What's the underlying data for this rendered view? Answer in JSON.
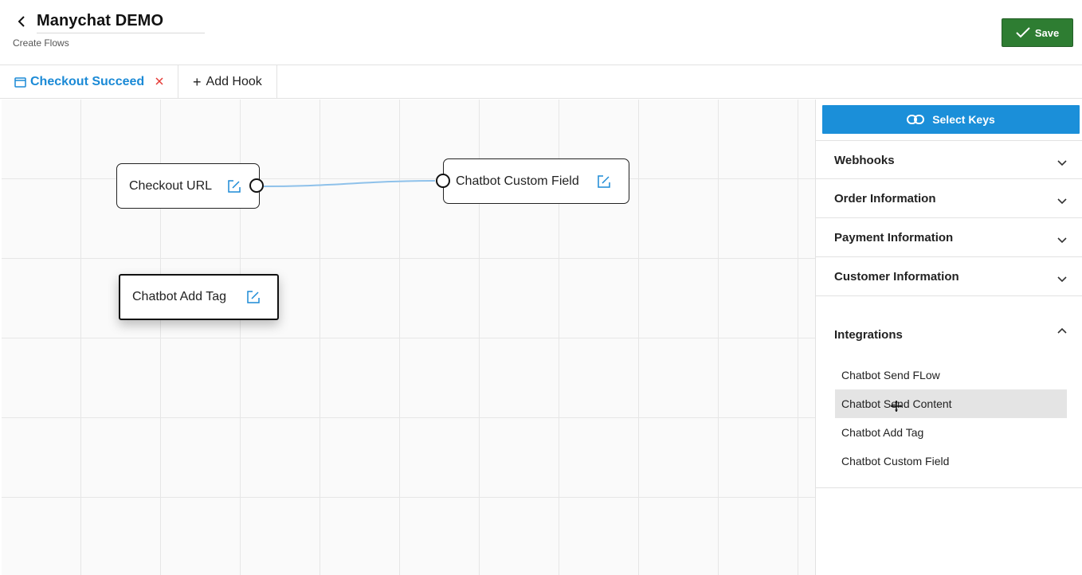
{
  "header": {
    "title": "Manychat DEMO",
    "subtitle": "Create Flows",
    "save_label": "Save",
    "save_color": "#2e7d32"
  },
  "tabs": {
    "active_label": "Checkout Succeed",
    "add_label": "Add Hook",
    "accent_color": "#1b8ad6"
  },
  "canvas": {
    "nodes": [
      {
        "label": "Checkout URL"
      },
      {
        "label": "Chatbot Custom Field"
      },
      {
        "label": "Chatbot Add Tag"
      }
    ]
  },
  "sidebar": {
    "select_keys_label": "Select Keys",
    "sections": [
      {
        "label": "Webhooks",
        "expanded": false
      },
      {
        "label": "Order Information",
        "expanded": false
      },
      {
        "label": "Payment Information",
        "expanded": false
      },
      {
        "label": "Customer Information",
        "expanded": false
      },
      {
        "label": "Integrations",
        "expanded": true
      }
    ],
    "integrations": [
      {
        "label": "Chatbot Send FLow"
      },
      {
        "label": "Chatbot Send Content"
      },
      {
        "label": "Chatbot Add Tag"
      },
      {
        "label": "Chatbot Custom Field"
      }
    ]
  },
  "icons": [
    "back-icon",
    "check-icon",
    "flow-tab-icon",
    "close-icon",
    "plus-icon",
    "edit-icon",
    "link-icon",
    "chevron-down-icon",
    "chevron-up-icon",
    "move-cursor-icon"
  ]
}
